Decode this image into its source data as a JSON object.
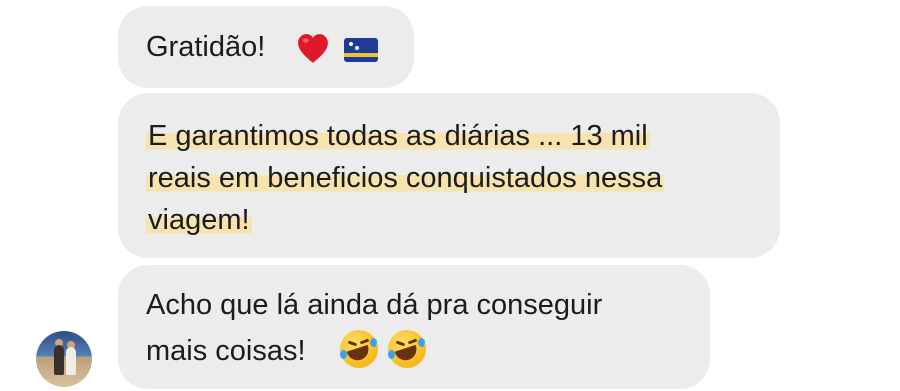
{
  "messages": [
    {
      "lines": [
        "Gratidão!"
      ],
      "emoji": [
        "red-heart",
        "curacao-flag"
      ]
    },
    {
      "lines": [
        "E garantimos todas as diárias ... 13 mil",
        "reais em beneficios conquistados nessa",
        "viagem!"
      ],
      "highlight_color": "#f6e3ad"
    },
    {
      "lines": [
        "Acho que lá ainda dá pra conseguir",
        "mais coisas!"
      ],
      "emoji": [
        "rolling-on-the-floor-laughing",
        "rolling-on-the-floor-laughing"
      ]
    }
  ],
  "colors": {
    "bubble": "#ececec",
    "text": "#1c1c1e",
    "highlight": "#f6e3ad"
  }
}
